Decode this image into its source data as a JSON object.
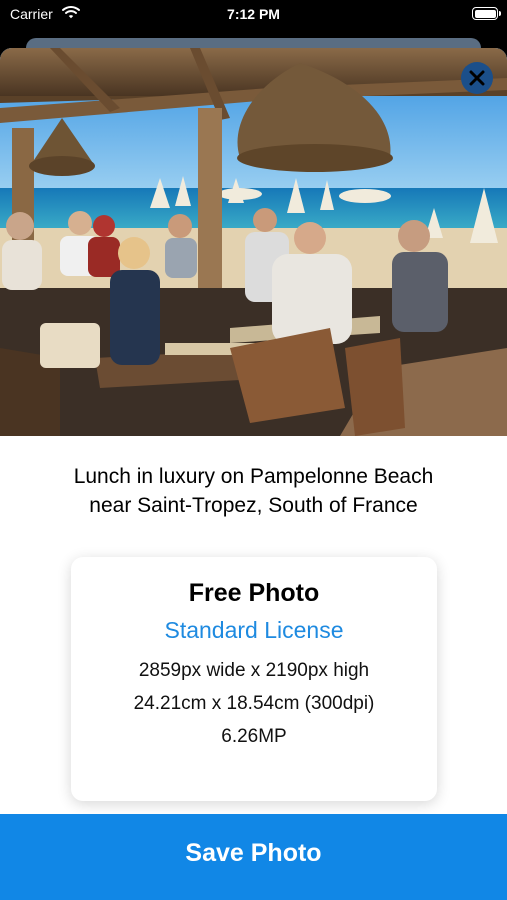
{
  "status_bar": {
    "carrier": "Carrier",
    "time": "7:12 PM"
  },
  "photo": {
    "alt": "Lunch in luxury on Pampelonne Beach near Saint-Tropez, South of France"
  },
  "caption": {
    "line1": "Lunch in luxury on Pampelonne Beach",
    "line2": "near Saint-Tropez, South of France"
  },
  "info_card": {
    "title": "Free Photo",
    "license": "Standard License",
    "pixels": "2859px wide x 2190px high",
    "print_size": "24.21cm x 18.54cm (300dpi)",
    "megapixels": "6.26MP"
  },
  "save_button": {
    "label": "Save Photo"
  },
  "colors": {
    "accent": "#1187e6",
    "license_link": "#1e8ae0",
    "close_button": "#1b4f8a"
  }
}
